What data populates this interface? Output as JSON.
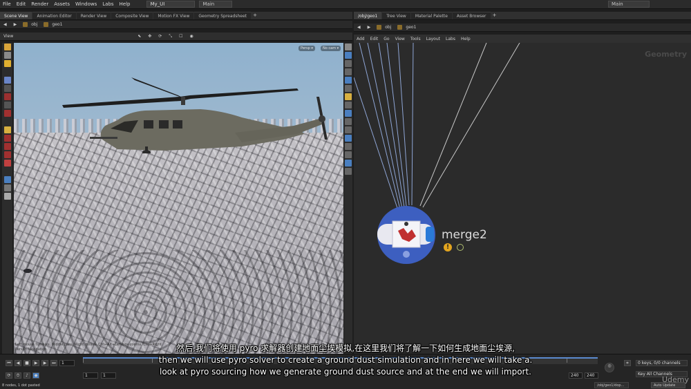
{
  "menubar": {
    "items": [
      "File",
      "Edit",
      "Render",
      "Assets",
      "Windows",
      "Labs",
      "Help"
    ],
    "desktop": "My_UI",
    "main_left": "Main",
    "main_right": "Main"
  },
  "left_tabs": [
    "Scene View",
    "Animation Editor",
    "Render View",
    "Composite View",
    "Motion FX View",
    "Geometry Spreadsheet"
  ],
  "right_tabs": [
    "/obj/geo1",
    "Tree View",
    "Material Palette",
    "Asset Browser"
  ],
  "left_path": {
    "obj": "obj",
    "geo": "geo1"
  },
  "right_path": {
    "obj": "obj",
    "geo": "geo1"
  },
  "viewport": {
    "title": "View",
    "persp_chip": "Persp ▾",
    "cam_chip": "No cam ▾",
    "help_line1": "Left mouse tumbles. Middle pans. Right dollies. Ctrl+Alt+Left box-zooms. Ctrl+Right",
    "help_line2": "Person Navigation."
  },
  "network": {
    "menu": [
      "Add",
      "Edit",
      "Go",
      "View",
      "Tools",
      "Layout",
      "Labs",
      "Help"
    ],
    "context_label": "Geometry",
    "node_name": "merge2"
  },
  "timeline": {
    "frame_current": "1",
    "start_frame": "1",
    "start_frame2": "1",
    "end_frame": "240",
    "end_frame2": "240",
    "keys_label": "0 keys, 0/0 channels",
    "key_all": "Key All Channels",
    "net_path": "/obj/geo1/dop...",
    "auto_update": "Auto Update"
  },
  "status": "8 nodes, 1 dot pasted",
  "subtitles": {
    "line1": "然后,我们将使用 pyro 求解器创建地面尘埃模拟,在这里我们将了解一下如何生成地面尘埃源,",
    "line2": "then we will use pyro solver to create a ground dust simulation and in here we will take a.",
    "line3": "look at pyro sourcing how we generate ground dust source and at the end we will import."
  },
  "watermark": "Udemy",
  "colors": {
    "accent_blue": "#5b8bd0",
    "node_ring": "#3d5fc0",
    "warning": "#e3a51f",
    "panel_bg": "#2b2b2b"
  }
}
